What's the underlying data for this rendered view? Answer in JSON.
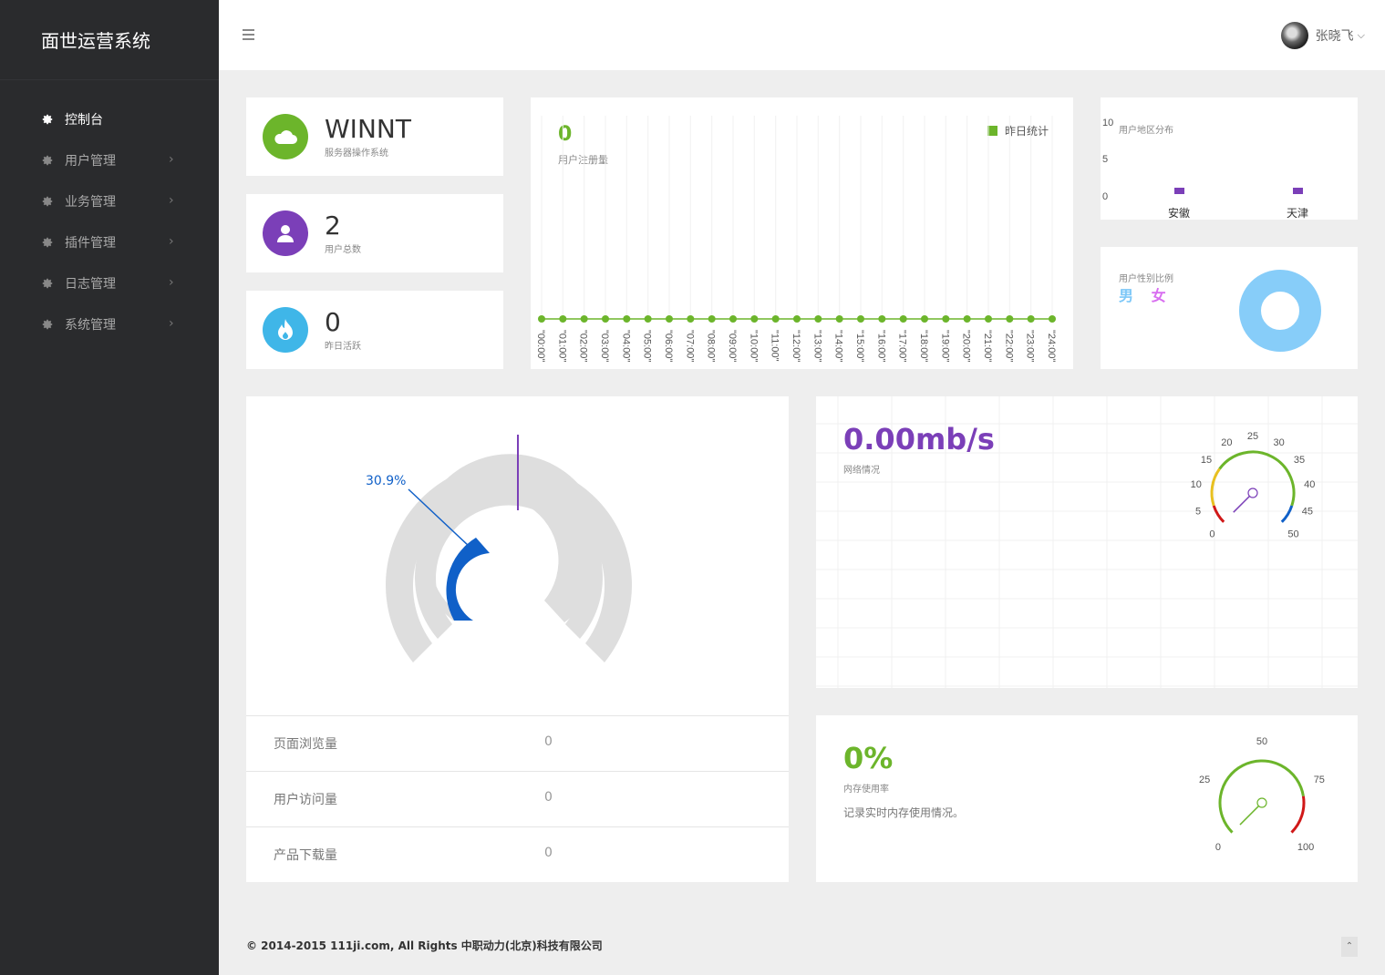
{
  "app": {
    "title": "面世运营系统"
  },
  "sidebar": {
    "items": [
      {
        "label": "控制台",
        "active": true
      },
      {
        "label": "用户管理"
      },
      {
        "label": "业务管理"
      },
      {
        "label": "插件管理"
      },
      {
        "label": "日志管理"
      },
      {
        "label": "系统管理"
      }
    ]
  },
  "topbar": {
    "username": "张晓飞"
  },
  "stats": [
    {
      "value": "WINNT",
      "label": "服务器操作系统",
      "color": "#6cb52b",
      "icon": "cloud-icon"
    },
    {
      "value": "2",
      "label": "用户总数",
      "color": "#7b3fb8",
      "icon": "user-icon"
    },
    {
      "value": "0",
      "label": "昨日活跃",
      "color": "#3fb6e8",
      "icon": "fire-icon"
    }
  ],
  "registrations": {
    "value": "0",
    "label": "用户注册量",
    "legend": "昨日统计",
    "color": "#6cb52b",
    "chart_data": {
      "type": "line",
      "categories": [
        "\"00:00\"",
        "\"01:00\"",
        "\"02:00\"",
        "\"03:00\"",
        "\"04:00\"",
        "\"05:00\"",
        "\"06:00\"",
        "\"07:00\"",
        "\"08:00\"",
        "\"09:00\"",
        "\"10:00\"",
        "\"11:00\"",
        "\"12:00\"",
        "\"13:00\"",
        "\"14:00\"",
        "\"15:00\"",
        "\"16:00\"",
        "\"17:00\"",
        "\"18:00\"",
        "\"19:00\"",
        "\"20:00\"",
        "\"21:00\"",
        "\"22:00\"",
        "\"23:00\"",
        "\"24:00\""
      ],
      "series": [
        {
          "name": "昨日统计",
          "values": [
            0,
            0,
            0,
            0,
            0,
            0,
            0,
            0,
            0,
            0,
            0,
            0,
            0,
            0,
            0,
            0,
            0,
            0,
            0,
            0,
            0,
            0,
            0,
            0,
            0
          ]
        }
      ]
    }
  },
  "region": {
    "title": "用户地区分布",
    "chart_data": {
      "type": "bar",
      "categories": [
        "安徽",
        "天津"
      ],
      "values": [
        0,
        0
      ],
      "yticks": [
        "10",
        "5",
        "0"
      ],
      "color": "#7b3fb8"
    }
  },
  "gender": {
    "title": "用户性别比例",
    "male": "男",
    "female": "女",
    "male_color": "#7ec8f8",
    "female_color": "#d86ef0",
    "chart_data": {
      "type": "pie",
      "labels": [
        "男",
        "女"
      ],
      "values": [
        100,
        0
      ]
    }
  },
  "visits_gauge": {
    "label": "30.9%",
    "chart_data": {
      "type": "pie",
      "value": 30.9
    }
  },
  "visits_table": [
    {
      "key": "页面浏览量",
      "value": "0"
    },
    {
      "key": "用户访问量",
      "value": "0"
    },
    {
      "key": "产品下载量",
      "value": "0"
    }
  ],
  "network": {
    "value": "0.00mb/s",
    "label": "网络情况",
    "color": "#7b3fb8",
    "gauge": {
      "value": 0,
      "min": 0,
      "max": 50,
      "ticks": [
        "0",
        "5",
        "10",
        "15",
        "20",
        "25",
        "30",
        "35",
        "40",
        "45",
        "50"
      ]
    }
  },
  "memory": {
    "value": "0%",
    "label": "内存使用率",
    "desc": "记录实时内存使用情况。",
    "color": "#6cb52b",
    "gauge": {
      "value": 0,
      "min": 0,
      "max": 100,
      "ticks": [
        "0",
        "25",
        "50",
        "75",
        "100"
      ]
    }
  },
  "footer": {
    "text": "© 2014-2015 111ji.com, All Rights 中职动力(北京)科技有限公司"
  }
}
